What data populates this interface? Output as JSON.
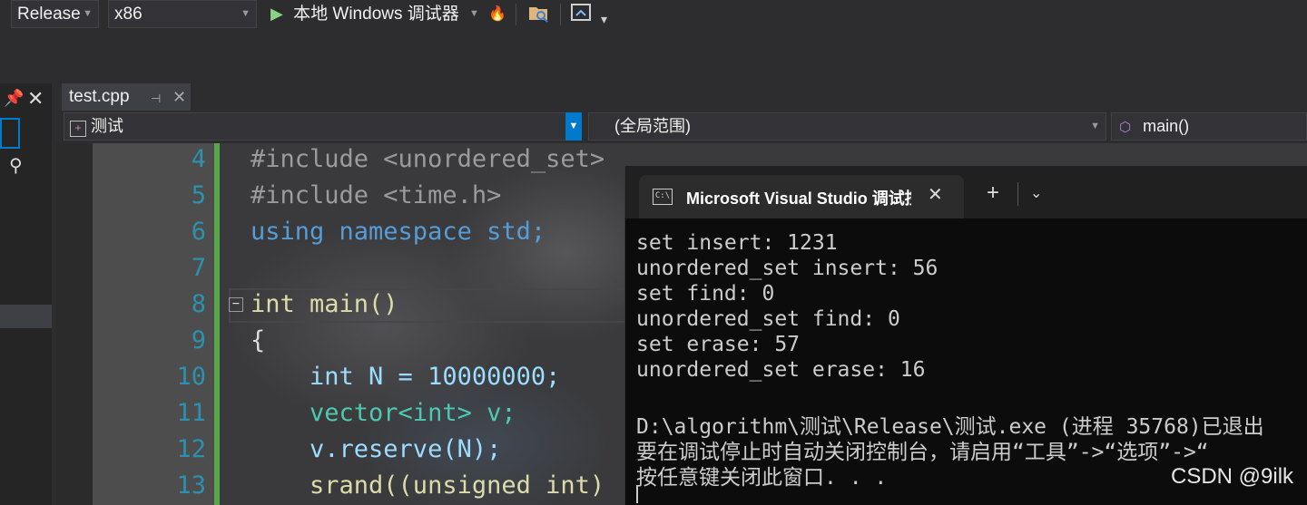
{
  "toolbar": {
    "config": "Release",
    "platform": "x86",
    "run_label": "本地 Windows 调试器"
  },
  "tab": {
    "filename": "test.cpp"
  },
  "navbar": {
    "project": "测试",
    "scope": "(全局范围)",
    "member": "main()"
  },
  "editor": {
    "line_numbers": [
      "4",
      "5",
      "6",
      "7",
      "8",
      "9",
      "10",
      "11",
      "12",
      "13"
    ],
    "lines": [
      "#include <unordered_set>",
      "#include <time.h>",
      "using namespace std;",
      "",
      "int main()",
      "{",
      "    int N = 10000000;",
      "    vector<int> v;",
      "    v.reserve(N);",
      "    srand((unsigned int)"
    ]
  },
  "console": {
    "title": "Microsoft Visual Studio 调试控",
    "output": [
      "set insert: 1231",
      "unordered_set insert: 56",
      "set find: 0",
      "unordered_set find: 0",
      "set erase: 57",
      "unordered_set erase: 16",
      "",
      "D:\\algorithm\\测试\\Release\\测试.exe (进程 35768)已退出",
      "要在调试停止时自动关闭控制台，请启用“工具”->“选项”->“",
      "按任意键关闭此窗口. . ."
    ]
  },
  "watermark": "CSDN @9ilk"
}
